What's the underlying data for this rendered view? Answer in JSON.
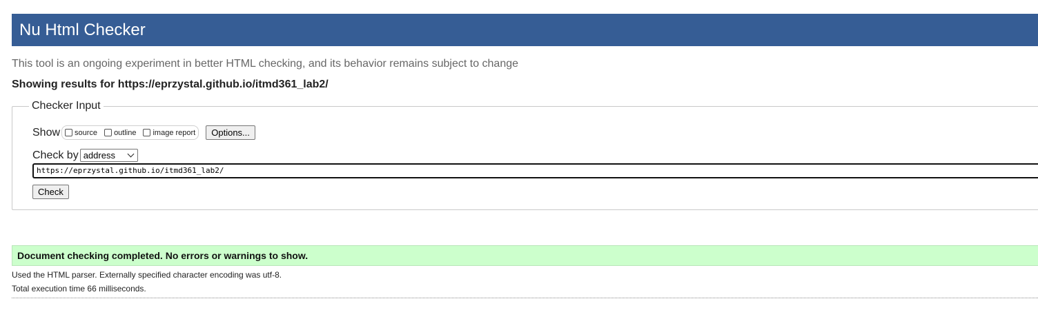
{
  "header": {
    "title": "Nu Html Checker"
  },
  "subtitle": "This tool is an ongoing experiment in better HTML checking, and its behavior remains subject to change",
  "showing_results": "Showing results for https://eprzystal.github.io/itmd361_lab2/",
  "checker_input": {
    "legend": "Checker Input",
    "show_label": "Show",
    "show_options": [
      {
        "label": "source",
        "checked": false
      },
      {
        "label": "outline",
        "checked": false
      },
      {
        "label": "image report",
        "checked": false
      }
    ],
    "options_button": "Options...",
    "check_by_label": "Check by",
    "check_by_selected": "address",
    "url_value": "https://eprzystal.github.io/itmd361_lab2/",
    "check_button": "Check"
  },
  "result": {
    "message": "Document checking completed. No errors or warnings to show.",
    "color": "#ccffcc"
  },
  "details": {
    "parser": "Used the HTML parser. Externally specified character encoding was utf-8.",
    "execution_time": "Total execution time 66 milliseconds."
  },
  "colors": {
    "header_bg": "#365d95"
  }
}
